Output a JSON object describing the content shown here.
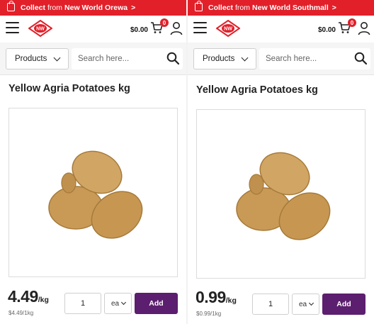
{
  "theme": {
    "brand_red": "#e2202a",
    "add_button_purple": "#5c1e6e",
    "potato_color": "#c99a56"
  },
  "panels": [
    {
      "promo": {
        "prefix": "Collect",
        "middle": "from",
        "store": "New World Orewa",
        "chevron": ">"
      },
      "cart": {
        "total": "$0.00",
        "count": "0"
      },
      "search": {
        "products_label": "Products",
        "placeholder": "Search here..."
      },
      "product": {
        "title": "Yellow Agria Potatoes kg",
        "price": "4.49",
        "price_unit": "/kg",
        "unit_price": "$4.49/1kg",
        "quantity": "1",
        "uom": "ea",
        "add_label": "Add"
      }
    },
    {
      "promo": {
        "prefix": "Collect",
        "middle": "from",
        "store": "New World Southmall",
        "chevron": ">"
      },
      "cart": {
        "total": "$0.00",
        "count": "0"
      },
      "search": {
        "products_label": "Products",
        "placeholder": "Search here..."
      },
      "product": {
        "title": "Yellow Agria Potatoes kg",
        "price": "0.99",
        "price_unit": "/kg",
        "unit_price": "$0.99/1kg",
        "quantity": "1",
        "uom": "ea",
        "add_label": "Add"
      }
    }
  ],
  "icons": {
    "bag": "shopping-bag-icon",
    "menu": "hamburger-menu-icon",
    "logo": "new-world-logo",
    "cart": "shopping-cart-icon",
    "user": "user-icon",
    "search": "search-icon",
    "chevron": "chevron-down-icon"
  }
}
